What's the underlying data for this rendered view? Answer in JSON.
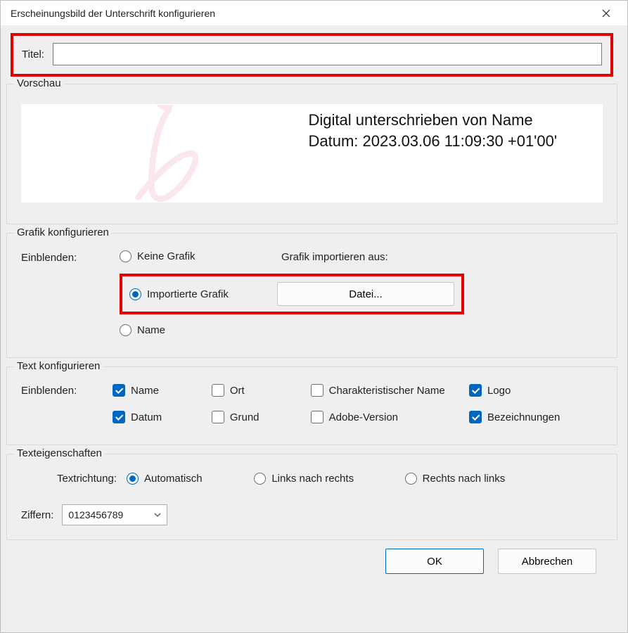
{
  "window": {
    "title": "Erscheinungsbild der Unterschrift konfigurieren"
  },
  "title_field": {
    "label": "Titel:",
    "value": ""
  },
  "preview": {
    "legend": "Vorschau",
    "signed_by": "Digital unterschrieben von Name",
    "date_line": "Datum: 2023.03.06 11:09:30 +01'00'"
  },
  "graphic": {
    "legend": "Grafik konfigurieren",
    "show_label": "Einblenden:",
    "options": {
      "none": "Keine Grafik",
      "imported": "Importierte Grafik",
      "name": "Name"
    },
    "selected": "imported",
    "import_label": "Grafik importieren aus:",
    "file_button": "Datei..."
  },
  "text": {
    "legend": "Text konfigurieren",
    "show_label": "Einblenden:",
    "checks": {
      "name": {
        "label": "Name",
        "checked": true
      },
      "ort": {
        "label": "Ort",
        "checked": false
      },
      "cn": {
        "label": "Charakteristischer Name",
        "checked": false
      },
      "logo": {
        "label": "Logo",
        "checked": true
      },
      "datum": {
        "label": "Datum",
        "checked": true
      },
      "grund": {
        "label": "Grund",
        "checked": false
      },
      "adobe": {
        "label": "Adobe-Version",
        "checked": false
      },
      "bez": {
        "label": "Bezeichnungen",
        "checked": true
      }
    }
  },
  "text_props": {
    "legend": "Texteigenschaften",
    "direction_label": "Textrichtung:",
    "direction_options": {
      "auto": "Automatisch",
      "ltr": "Links nach rechts",
      "rtl": "Rechts nach links"
    },
    "direction_selected": "auto",
    "digits_label": "Ziffern:",
    "digits_value": "0123456789"
  },
  "footer": {
    "ok": "OK",
    "cancel": "Abbrechen"
  }
}
